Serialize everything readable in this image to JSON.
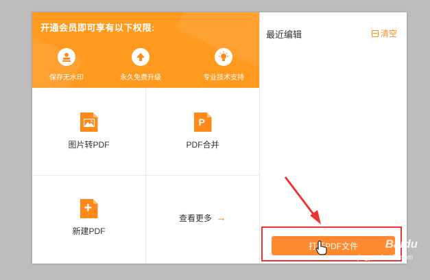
{
  "banner": {
    "title": "开通会员即可享有以下权限:",
    "perks": [
      {
        "label": "保存无水印",
        "icon": "stamp-icon"
      },
      {
        "label": "永久免费升级",
        "icon": "upgrade-arrow-icon"
      },
      {
        "label": "专业技术支持",
        "icon": "lightbulb-icon"
      }
    ]
  },
  "tiles": [
    {
      "label": "图片转PDF",
      "icon": "image-file-icon"
    },
    {
      "label": "PDF合并",
      "icon": "pdf-merge-icon"
    },
    {
      "label": "新建PDF",
      "icon": "new-file-icon"
    },
    {
      "label": "查看更多",
      "icon": "arrow-right-icon"
    }
  ],
  "recent": {
    "title": "最近编辑",
    "clear_label": "清空"
  },
  "open_button": {
    "label": "打开PDF文件"
  },
  "watermark": {
    "brand": "Baidu",
    "sub": "jingyan.baidu.com"
  },
  "colors": {
    "accent": "#ff8a1a",
    "banner": "#ff9a1f",
    "highlight": "#e33333"
  }
}
